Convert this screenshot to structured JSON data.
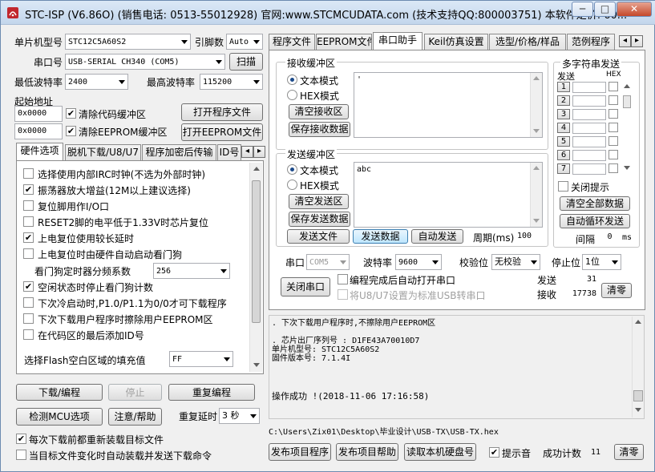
{
  "window": {
    "title": "STC-ISP (V6.86O) (销售电话: 0513-55012928) 官网:www.STCMCUDATA.com  (技术支持QQ:800003751) 本软件定价: 60...",
    "min_label": "─",
    "max_label": "□",
    "close_label": "✕"
  },
  "left": {
    "mcu_label": "单片机型号",
    "mcu_value": "STC12C5A60S2",
    "pins_label": "引脚数",
    "pins_value": "Auto",
    "port_label": "串口号",
    "port_value": "USB-SERIAL CH340 (COM5)",
    "scan_btn": "扫描",
    "min_baud_label": "最低波特率",
    "min_baud_value": "2400",
    "max_baud_label": "最高波特率",
    "max_baud_value": "115200",
    "start_addr_label": "起始地址",
    "code_addr": "0x0000",
    "clear_code_label": "清除代码缓冲区",
    "open_prog_btn": "打开程序文件",
    "eeprom_addr": "0x0000",
    "clear_eeprom_label": "清除EEPROM缓冲区",
    "open_eeprom_btn": "打开EEPROM文件",
    "hw_tabs": [
      "硬件选项",
      "脱机下载/U8/U7",
      "程序加密后传输",
      "ID号"
    ],
    "hw_options": [
      {
        "label": "选择使用内部IRC时钟(不选为外部时钟)",
        "checked": false
      },
      {
        "label": "振荡器放大增益(12M以上建议选择)",
        "checked": true
      },
      {
        "label": "复位脚用作I/O口",
        "checked": false
      },
      {
        "label": "RESET2脚的电平低于1.33V时芯片复位",
        "checked": false
      },
      {
        "label": "上电复位使用较长延时",
        "checked": true
      },
      {
        "label": "上电复位时由硬件自动启动看门狗",
        "checked": false
      }
    ],
    "wdt_label": "看门狗定时器分频系数",
    "wdt_value": "256",
    "hw_options2": [
      {
        "label": "空闲状态时停止看门狗计数",
        "checked": true
      },
      {
        "label": "下次冷启动时,P1.0/P1.1为0/0才可下载程序",
        "checked": false
      },
      {
        "label": "下次下载用户程序时擦除用户EEPROM区",
        "checked": false
      },
      {
        "label": "在代码区的最后添加ID号",
        "checked": false
      }
    ],
    "fill_label": "选择Flash空白区域的填充值",
    "fill_value": "FF",
    "download_btn": "下载/编程",
    "stop_btn": "停止",
    "reprog_btn": "重复编程",
    "detect_btn": "检测MCU选项",
    "help_btn": "注意/帮助",
    "delay_label": "重复延时",
    "delay_value": "3 秒",
    "reload_label": "每次下载前都重新装载目标文件",
    "reload_checked": true,
    "auto_label": "当目标文件变化时自动装载并发送下载命令",
    "auto_checked": false
  },
  "right": {
    "tabs": [
      "程序文件",
      "EEPROM文件",
      "串口助手",
      "Keil仿真设置",
      "选型/价格/样品",
      "范例程序"
    ],
    "active_tab": "串口助手",
    "recv": {
      "title": "接收缓冲区",
      "text_mode": "文本模式",
      "hex_mode": "HEX模式",
      "clear_btn": "清空接收区",
      "save_btn": "保存接收数据",
      "content": "'"
    },
    "send": {
      "title": "发送缓冲区",
      "text_mode": "文本模式",
      "hex_mode": "HEX模式",
      "clear_btn": "清空发送区",
      "save_btn": "保存发送数据",
      "content": "abc"
    },
    "send_file_btn": "发送文件",
    "send_data_btn": "发送数据",
    "auto_send_btn": "自动发送",
    "period_label": "周期(ms)",
    "period_value": "100",
    "multi": {
      "title": "多字符串发送",
      "send_header": "发送",
      "hex_header": "HEX",
      "rows": [
        "1",
        "2",
        "3",
        "4",
        "5",
        "6",
        "7"
      ],
      "close_tip_label": "关闭提示",
      "clear_all_btn": "清空全部数据",
      "auto_loop_btn": "自动循环发送",
      "interval_label": "间隔",
      "interval_value": "0",
      "interval_unit": "ms"
    },
    "port_label": "串口",
    "port_value": "COM5",
    "baud_label": "波特率",
    "baud_value": "9600",
    "parity_label": "校验位",
    "parity_value": "无校验",
    "stop_label": "停止位",
    "stop_value": "1位",
    "close_port_btn": "关闭串口",
    "auto_open_label": "编程完成后自动打开串口",
    "usb_label": "将U8/U7设置为标准USB转串口",
    "sent_label": "发送",
    "sent_value": "31",
    "recv_label": "接收",
    "recv_value": "17738",
    "clear_count_btn": "清零"
  },
  "log": {
    "lines": [
      ". 下次下载用户程序时,不擦除用户EEPROM区",
      "",
      ". 芯片出厂序列号 : D1FE43A70010D7",
      "单片机型号: STC12C5A60S2",
      "固件版本号: 7.1.4I",
      "",
      "",
      "操作成功 !(2018-11-06 17:16:58)"
    ]
  },
  "bottom": {
    "path": "C:\\Users\\Zix01\\Desktop\\毕业设计\\USB-TX\\USB-TX.hex",
    "publish_btn": "发布项目程序",
    "publish_help_btn": "发布项目帮助",
    "read_disk_btn": "读取本机硬盘号",
    "sound_label": "提示音",
    "sound_checked": true,
    "success_label": "成功计数",
    "success_value": "11",
    "clear_btn": "清零"
  }
}
